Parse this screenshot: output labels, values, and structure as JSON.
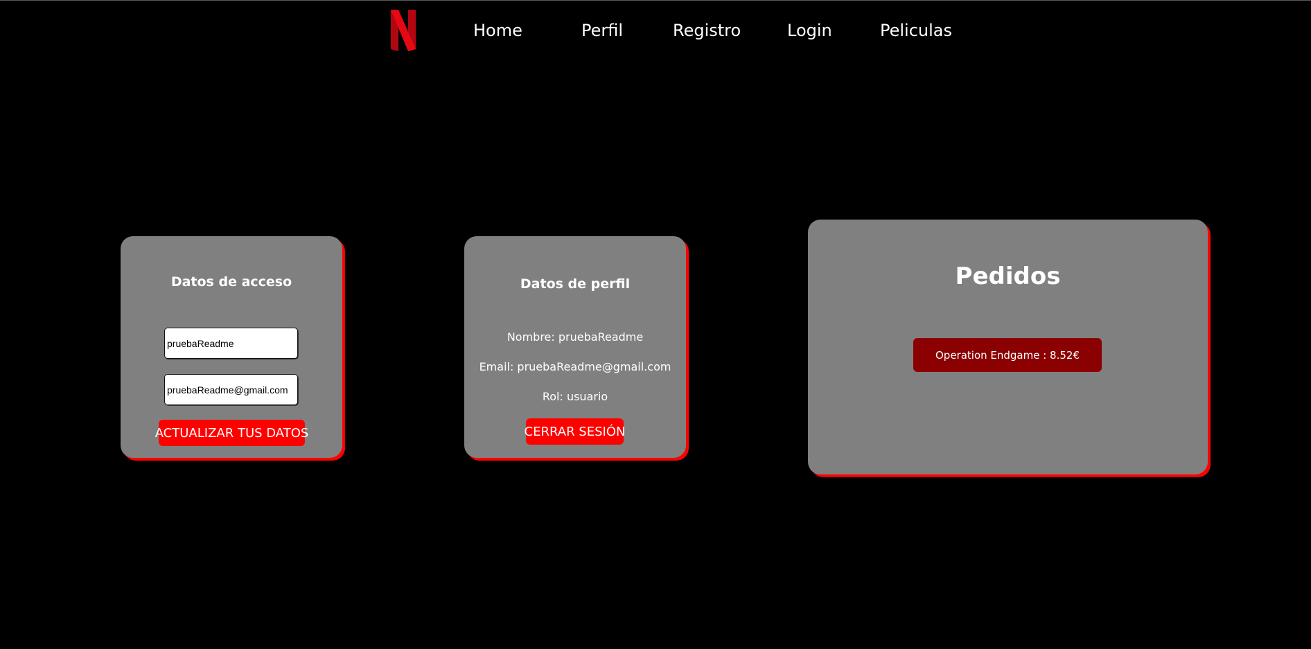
{
  "nav": {
    "logo_alt": "N",
    "links": [
      {
        "label": "Home"
      },
      {
        "label": "Perfil"
      },
      {
        "label": "Registro"
      },
      {
        "label": "Login"
      },
      {
        "label": "Peliculas"
      }
    ]
  },
  "access_card": {
    "title": "Datos de acceso",
    "username_value": "pruebaReadme",
    "email_value": "pruebaReadme@gmail.com",
    "update_button": "ACTUALIZAR TUS DATOS"
  },
  "profile_card": {
    "title": "Datos de perfil",
    "name_line": "Nombre: pruebaReadme",
    "email_line": "Email: pruebaReadme@gmail.com",
    "role_line": "Rol: usuario",
    "logout_button": "CERRAR SESIÓN"
  },
  "orders_card": {
    "title": "Pedidos",
    "orders": [
      {
        "label": "Operation Endgame : 8.52€"
      }
    ]
  },
  "colors": {
    "background": "#000000",
    "card": "#808080",
    "accent_red": "#ff0000",
    "order_item": "#8b0000",
    "logo_red": "#e50914"
  }
}
